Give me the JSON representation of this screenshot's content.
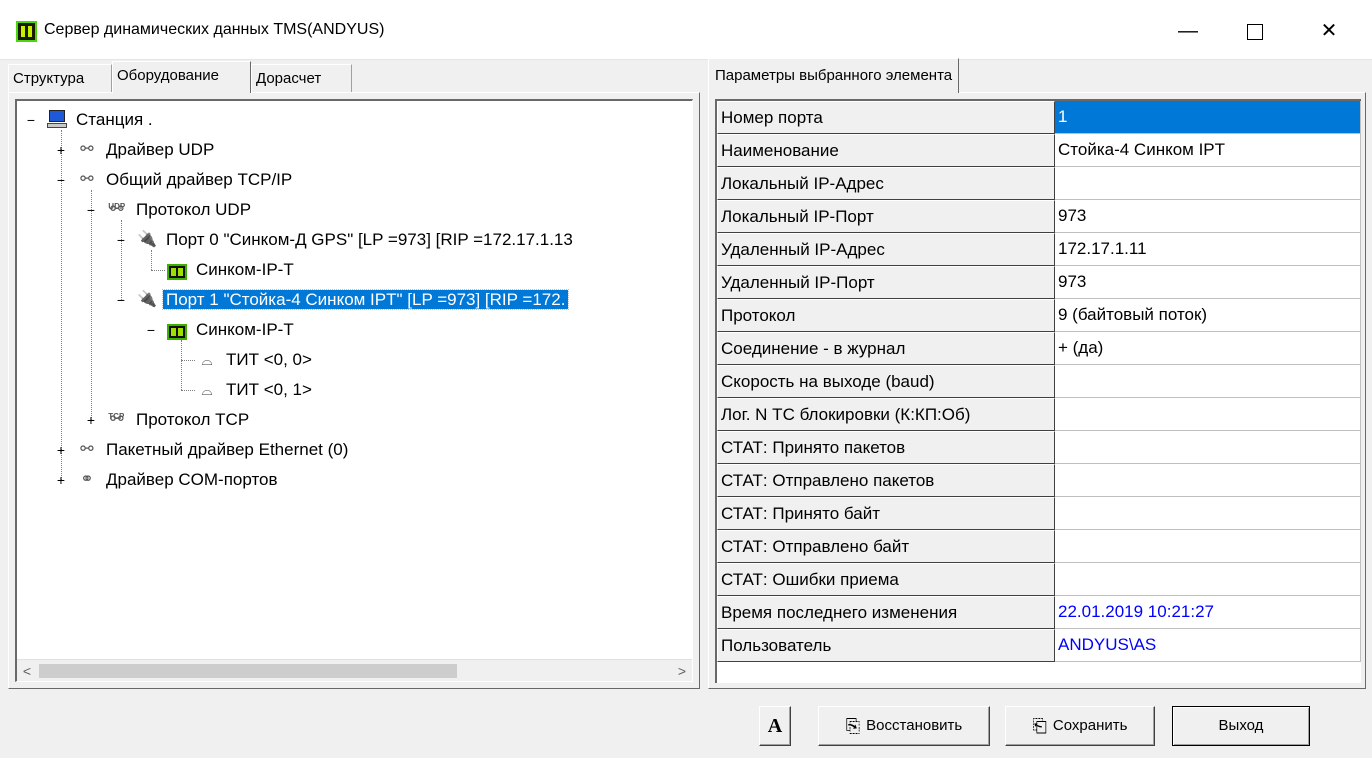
{
  "window": {
    "title": "Сервер динамических данных TMS(ANDYUS)",
    "minimize": "—",
    "close": "✕"
  },
  "left_tabs": [
    "Структура",
    "Оборудование",
    "Дорасчет"
  ],
  "active_left_tab": "Оборудование",
  "tree": {
    "nodes": [
      {
        "label": "Станция .",
        "expander": "−",
        "icon": "computer-icon"
      },
      {
        "label": "Драйвер UDP",
        "expander": "+",
        "icon": "driver-icon"
      },
      {
        "label": "Общий драйвер TCP/IP",
        "expander": "−",
        "icon": "driver-icon"
      },
      {
        "label": "Протокол UDP",
        "expander": "−",
        "icon": "udp-protocol-icon",
        "icon_text": "UDP"
      },
      {
        "label": "Порт  0 \"Синком-Д GPS\" [LP =973] [RIP =172.17.1.13",
        "expander": "−",
        "icon": "port-icon"
      },
      {
        "label": "Синком-IP-T",
        "expander": "",
        "icon": "device-icon"
      },
      {
        "label": "Порт  1 \"Стойка-4 Синком IPT\" [LP =973] [RIP =172.",
        "expander": "−",
        "icon": "port-icon",
        "selected": true
      },
      {
        "label": "Синком-IP-T",
        "expander": "−",
        "icon": "device-icon"
      },
      {
        "label": "ТИТ  <0, 0>",
        "expander": "",
        "icon": "gauge-icon"
      },
      {
        "label": "ТИТ  <0, 1>",
        "expander": "",
        "icon": "gauge-icon"
      },
      {
        "label": "Протокол TCP",
        "expander": "+",
        "icon": "tcp-protocol-icon",
        "icon_text": "TCP"
      },
      {
        "label": "Пакетный драйвер Ethernet  (0)",
        "expander": "+",
        "icon": "driver-icon"
      },
      {
        "label": "Драйвер COM-портов",
        "expander": "+",
        "icon": "com-driver-icon"
      }
    ]
  },
  "right_tab": "Параметры выбранного элемента",
  "properties": [
    {
      "name": "Номер порта",
      "value": "1",
      "style": "hl"
    },
    {
      "name": "Наименование",
      "value": "Стойка-4 Синком IPT",
      "style": ""
    },
    {
      "name": "Локальный IP-Адрес",
      "value": "",
      "style": ""
    },
    {
      "name": "Локальный IP-Порт",
      "value": "973",
      "style": ""
    },
    {
      "name": "Удаленный IP-Адрес",
      "value": "172.17.1.11",
      "style": ""
    },
    {
      "name": "Удаленный IP-Порт",
      "value": "973",
      "style": ""
    },
    {
      "name": "Протокол",
      "value": "9 (байтовый поток)",
      "style": ""
    },
    {
      "name": "Соединение - в журнал",
      "value": "+ (да)",
      "style": ""
    },
    {
      "name": "Скорость на выходе (baud)",
      "value": "",
      "style": ""
    },
    {
      "name": "Лог. N ТС блокировки (К:КП:Об)",
      "value": "",
      "style": ""
    },
    {
      "name": "СТАТ: Принято пакетов",
      "value": "",
      "style": ""
    },
    {
      "name": "СТАТ: Отправлено пакетов",
      "value": "",
      "style": ""
    },
    {
      "name": "СТАТ: Принято байт",
      "value": "",
      "style": ""
    },
    {
      "name": "СТАТ: Отправлено байт",
      "value": "",
      "style": ""
    },
    {
      "name": "СТАТ: Ошибки приема",
      "value": "",
      "style": ""
    },
    {
      "name": "Время последнего изменения",
      "value": "22.01.2019 10:21:27",
      "style": "blue"
    },
    {
      "name": "Пользователь",
      "value": "ANDYUS\\AS",
      "style": "blue"
    }
  ],
  "buttons": {
    "font": "A",
    "restore": "Восстановить",
    "save": "Сохранить",
    "exit": "Выход"
  },
  "scrollbar": {
    "left_arrow": "<",
    "right_arrow": ">"
  },
  "colors": {
    "selection": "#0078d7",
    "link_value": "#0000ff",
    "window_bg": "#f0f0f0"
  }
}
